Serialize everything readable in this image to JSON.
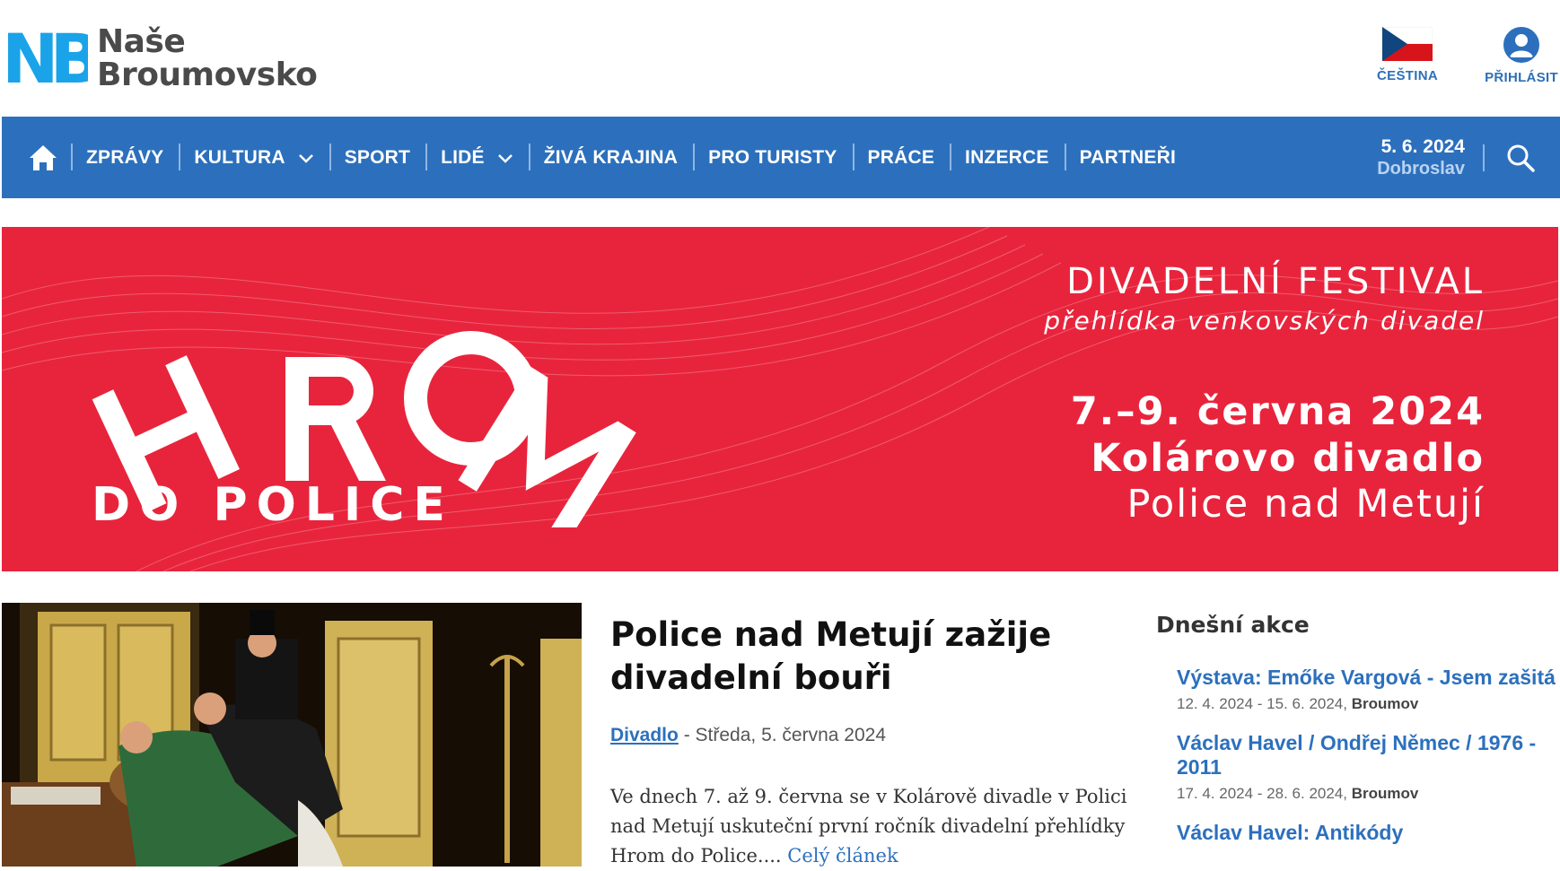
{
  "header": {
    "logo_mark": "NB",
    "logo_line1": "Naše",
    "logo_line2": "Broumovsko",
    "language_label": "ČEŠTINA",
    "login_label": "PŘIHLÁSIT"
  },
  "nav": {
    "items": [
      {
        "label": "ZPRÁVY",
        "dropdown": false
      },
      {
        "label": "KULTURA",
        "dropdown": true
      },
      {
        "label": "SPORT",
        "dropdown": false
      },
      {
        "label": "LIDÉ",
        "dropdown": true
      },
      {
        "label": "ŽIVÁ KRAJINA",
        "dropdown": false
      },
      {
        "label": "PRO TURISTY",
        "dropdown": false
      },
      {
        "label": "PRÁCE",
        "dropdown": false
      },
      {
        "label": "INZERCE",
        "dropdown": false
      },
      {
        "label": "PARTNEŘI",
        "dropdown": false
      }
    ],
    "date": "5. 6. 2024",
    "nameday": "Dobroslav"
  },
  "banner": {
    "logo_big": "HROM",
    "logo_small": "DO POLICE",
    "title": "DIVADELNÍ FESTIVAL",
    "subtitle": "přehlídka venkovských divadel",
    "dates": "7.–9. června 2024",
    "venue": "Kolárovo divadlo",
    "place": "Police nad Metují"
  },
  "article": {
    "title": "Police nad Metují zažije divadelní bouři",
    "category": "Divadlo",
    "date": " - Středa, 5. června 2024",
    "excerpt": "Ve dnech 7. až 9. června se v Kolárově divadle v Polici nad Metují uskuteční první ročník divadelní přehlídky Hrom do Police.... ",
    "read_more": "Celý článek"
  },
  "events": {
    "heading": "Dnešní akce",
    "items": [
      {
        "title": "Výstava: Emőke Vargová - Jsem zašitá",
        "dates": "12. 4. 2024 - 15. 6. 2024, ",
        "place": "Broumov"
      },
      {
        "title": "Václav Havel / Ondřej Němec / 1976 - 2011",
        "dates": "17. 4. 2024 - 28. 6. 2024, ",
        "place": "Broumov"
      },
      {
        "title": "Václav Havel: Antikódy",
        "dates": "",
        "place": ""
      }
    ]
  },
  "colors": {
    "brand_blue": "#2c70bd",
    "logo_cyan": "#1aa3e8",
    "banner_red": "#e8243c"
  }
}
